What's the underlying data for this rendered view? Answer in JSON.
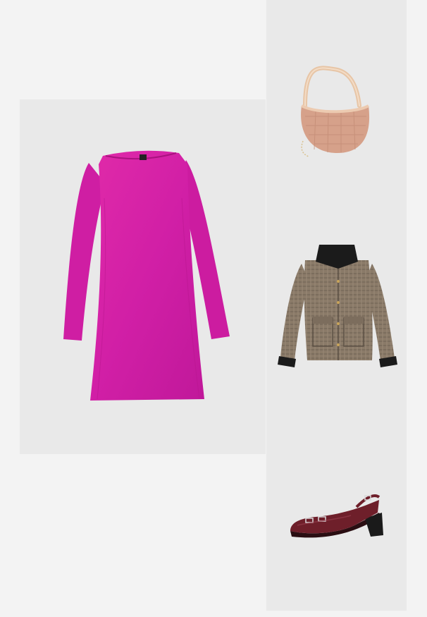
{
  "products": [
    {
      "id": "dress",
      "item": "dress-icon",
      "color": "#d11fa6"
    },
    {
      "id": "bag",
      "item": "bag-icon",
      "color": "#d9a58c"
    },
    {
      "id": "jacket",
      "item": "jacket-icon",
      "color": "#8a7a68"
    },
    {
      "id": "shoe",
      "item": "shoe-icon",
      "color": "#6e1f2a"
    }
  ]
}
